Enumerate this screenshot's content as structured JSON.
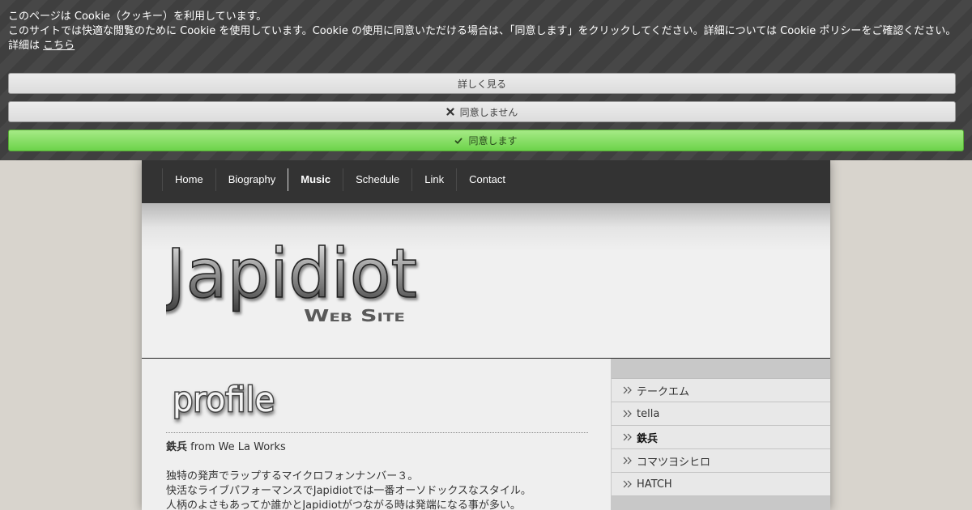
{
  "cookie_banner": {
    "line1": "このページは Cookie（クッキー）を利用しています。",
    "line2": "このサイトでは快適な閲覧のために Cookie を使用しています。Cookie の使用に同意いただける場合は、「同意します」をクリックしてください。詳細については Cookie ポリシーをご確認ください。",
    "line3_prefix": "詳細は",
    "line3_link": "こちら",
    "details_button": "詳しく見る",
    "decline_button": "同意しません",
    "accept_button": "同意します"
  },
  "nav": {
    "items": [
      {
        "label": "Home"
      },
      {
        "label": "Biography"
      },
      {
        "label": "Music",
        "active": true
      },
      {
        "label": "Schedule"
      },
      {
        "label": "Link"
      },
      {
        "label": "Contact"
      }
    ]
  },
  "header": {
    "logo_main": "Japidiot",
    "logo_sub": "Web Site"
  },
  "content": {
    "section_title": "profile",
    "name": "鉄兵",
    "name_suffix": " from We La Works",
    "paragraph": [
      "独特の発声でラップするマイクロフォンナンバー３。",
      "快活なライブパフォーマンスでJapidiotでは一番オーソドックスなスタイル。",
      "人柄のよさもあってか誰かとJapidiotがつながる時は発端になる事が多い。"
    ]
  },
  "sidebar": {
    "items": [
      {
        "label": "テークエム"
      },
      {
        "label": "tella"
      },
      {
        "label": "鉄兵",
        "current": true
      },
      {
        "label": "コマツヨシヒロ"
      },
      {
        "label": "HATCH"
      }
    ]
  },
  "colors": {
    "accept_green": "#6cd34a",
    "nav_bg": "#333333",
    "banner_bg": "#3f3f3f"
  },
  "icons": {
    "decline": "close-icon",
    "accept": "check-icon",
    "sidebar_bullet": "double-chevron-right-icon"
  }
}
